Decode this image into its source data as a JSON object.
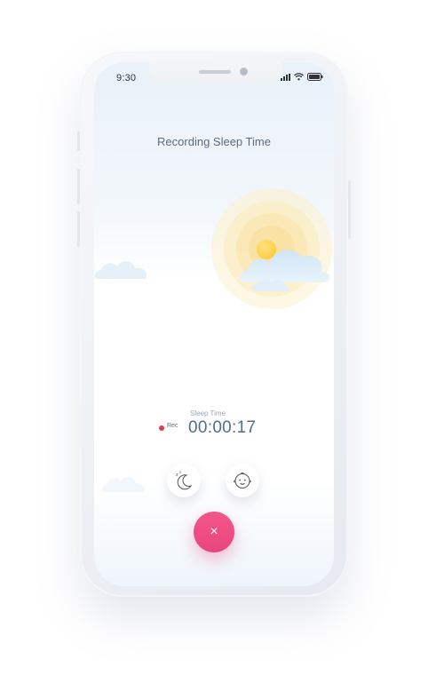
{
  "status_bar": {
    "time": "9:30",
    "icons": [
      "signal-icon",
      "wifi-icon",
      "battery-icon"
    ]
  },
  "header": {
    "title": "Recording Sleep Time"
  },
  "recording": {
    "rec_label": "Rec",
    "timer_label": "Sleep Time",
    "timer_value": "00:00:17"
  },
  "actions": {
    "sleep_icon": "moon-sleep-icon",
    "baby_icon": "baby-face-icon",
    "close_glyph": "×",
    "close_icon": "close-icon"
  },
  "colors": {
    "accent_pink": "#e8477c",
    "rec_red": "#e63659",
    "text_blue": "#4f6f8e",
    "sun_yellow": "#f8c730"
  }
}
